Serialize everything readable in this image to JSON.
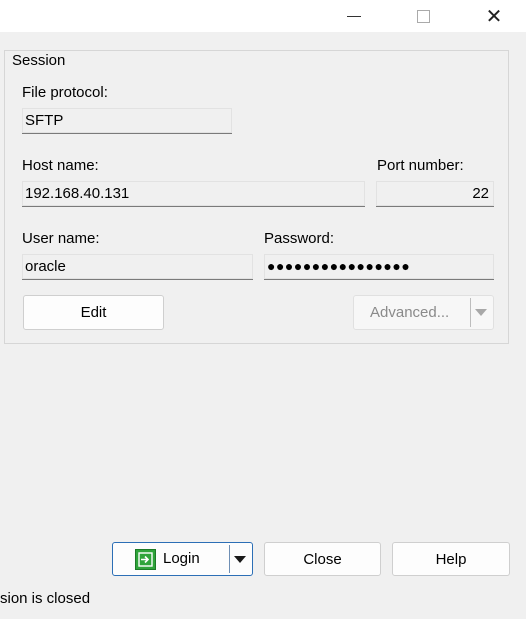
{
  "window": {
    "minimize_icon": "minimize-icon",
    "maximize_icon": "maximize-icon",
    "close_glyph": "✕"
  },
  "session": {
    "legend": "Session",
    "file_protocol": {
      "label": "File protocol:",
      "value": "SFTP"
    },
    "host_name": {
      "label": "Host name:",
      "value": "192.168.40.131"
    },
    "port_number": {
      "label": "Port number:",
      "value": "22"
    },
    "user_name": {
      "label": "User name:",
      "value": "oracle"
    },
    "password": {
      "label": "Password:",
      "value": "●●●●●●●●●●●●●●●●"
    },
    "edit_label": "Edit",
    "advanced_label": "Advanced..."
  },
  "footer": {
    "login_label": "Login",
    "close_label": "Close",
    "help_label": "Help",
    "status_text": "sion is closed"
  },
  "colors": {
    "login_icon": "#2fa43a",
    "primary_border": "#2c6fb6"
  }
}
